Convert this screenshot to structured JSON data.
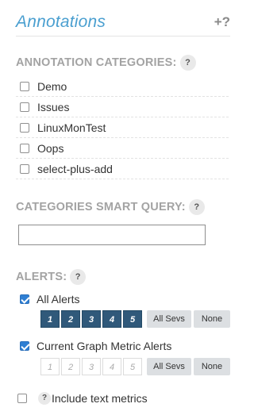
{
  "header": {
    "title": "Annotations",
    "add_help": "+?"
  },
  "categories": {
    "title": "ANNOTATION CATEGORIES:",
    "help": "?",
    "items": [
      {
        "label": "Demo",
        "checked": false
      },
      {
        "label": "Issues",
        "checked": false
      },
      {
        "label": "LinuxMonTest",
        "checked": false
      },
      {
        "label": "Oops",
        "checked": false
      },
      {
        "label": "select-plus-add",
        "checked": false
      }
    ]
  },
  "smart_query": {
    "title": "CATEGORIES SMART QUERY:",
    "help": "?",
    "value": "",
    "placeholder": ""
  },
  "alerts": {
    "title": "ALERTS:",
    "help": "?",
    "all_alerts": {
      "label": "All Alerts",
      "checked": true,
      "severities": [
        {
          "label": "1",
          "active": true
        },
        {
          "label": "2",
          "active": true
        },
        {
          "label": "3",
          "active": true
        },
        {
          "label": "4",
          "active": true
        },
        {
          "label": "5",
          "active": true
        }
      ],
      "all_sevs": "All Sevs",
      "none": "None"
    },
    "graph_alerts": {
      "label": "Current Graph Metric Alerts",
      "checked": true,
      "severities": [
        {
          "label": "1",
          "active": false
        },
        {
          "label": "2",
          "active": false
        },
        {
          "label": "3",
          "active": false
        },
        {
          "label": "4",
          "active": false
        },
        {
          "label": "5",
          "active": false
        }
      ],
      "all_sevs": "All Sevs",
      "none": "None"
    }
  },
  "include_text": {
    "label": "Include text metrics",
    "help": "?",
    "checked": false
  },
  "colors": {
    "accent": "#4a9fd0",
    "sev_active": "#30597a",
    "checkbox": "#2f7fd3",
    "section": "#a3a3a3"
  }
}
